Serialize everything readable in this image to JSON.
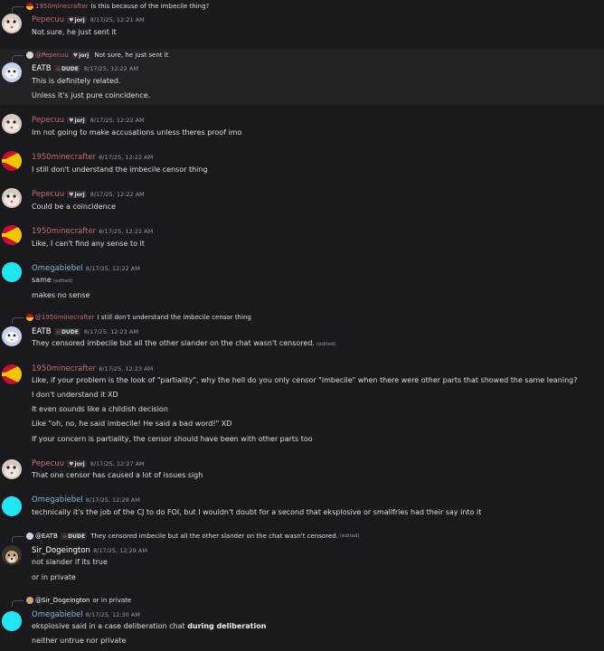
{
  "colors": {
    "pepecuu": "#c06b6b",
    "minecrafter": "#c06b6b",
    "eatb": "#ffffff",
    "omegabiebel": "#7ab8c8",
    "dogeington": "#ffffff",
    "mention": "#c9cdfb",
    "background": "#1a1a1e"
  },
  "messages": [
    {
      "reply": {
        "avatar_icon": "flag-icon",
        "name": "1950minecrafter",
        "text": "Is this because of the imbecile thing?"
      },
      "author": "Pepecuu",
      "tag": {
        "icon": "heart-icon",
        "label": "jorj"
      },
      "time": "8/17/25, 12:21 AM",
      "lines": [
        "Not sure, he just sent it"
      ]
    },
    {
      "reply": {
        "avatar_icon": "opossum-icon",
        "name": "@Pepecuu",
        "tag": "jorj",
        "text": "Not sure, he just sent it"
      },
      "author": "EATB",
      "tag": {
        "icon": "skull-icon",
        "label": "DUDE"
      },
      "time": "8/17/25, 12:22 AM",
      "lines": [
        "This is definitely related.",
        "Unless it's just pure coincidence."
      ]
    },
    {
      "author": "Pepecuu",
      "tag": {
        "icon": "heart-icon",
        "label": "jorj"
      },
      "time": "8/17/25, 12:22 AM",
      "lines": [
        "Im not going to make accusations unless theres proof imo"
      ]
    },
    {
      "author": "1950minecrafter",
      "time": "8/17/25, 12:22 AM",
      "lines": [
        "I still don't understand the imbecile censor thing"
      ]
    },
    {
      "author": "Pepecuu",
      "tag": {
        "icon": "heart-icon",
        "label": "jorj"
      },
      "time": "8/17/25, 12:22 AM",
      "lines": [
        "Could be a coincidence"
      ]
    },
    {
      "author": "1950minecrafter",
      "time": "8/17/25, 12:22 AM",
      "lines": [
        "Like, I can't find any sense to it"
      ]
    },
    {
      "author": "Omegabiebel",
      "time": "8/17/25, 12:22 AM",
      "lines": [
        "same",
        "makes no sense"
      ],
      "edited_label": "(edited)"
    },
    {
      "reply": {
        "avatar_icon": "flag-icon",
        "name": "@1950minecrafter",
        "text": "I still don't understand the imbecile censor thing"
      },
      "author": "EATB",
      "tag": {
        "icon": "skull-icon",
        "label": "DUDE"
      },
      "time": "8/17/25, 12:23 AM",
      "lines": [
        "They censored imbecile but all the other slander on the chat wasn't censored."
      ],
      "edited_label": "(edited)"
    },
    {
      "author": "1950minecrafter",
      "time": "8/17/25, 12:23 AM",
      "lines": [
        "Like, if your problem is the look of \"partiality\", why the hell do you only censor \"imbecile\" when there were other parts that showed the same leaning?",
        "I don't understand it XD",
        "It even sounds like a childish decision",
        "Like \"oh, no, he said imbecile! He said a bad word!\" XD",
        "If your concern is partiality, the censor should have been with other parts too"
      ]
    },
    {
      "author": "Pepecuu",
      "tag": {
        "icon": "heart-icon",
        "label": "jorj"
      },
      "time": "8/17/25, 12:27 AM",
      "lines": [
        "That one censor has caused a lot of issues sigh"
      ]
    },
    {
      "author": "Omegabiebel",
      "time": "8/17/25, 12:29 AM",
      "lines": [
        "technically it's the job of the CJ to do FOI, but I wouldn't doubt for a second that eksplosive or smallfries had their say into it"
      ]
    },
    {
      "reply": {
        "avatar_icon": "opossum-icon",
        "name": "@EATB",
        "tag": "DUDE",
        "text": "They censored imbecile but all the other slander on the chat wasn't censored.",
        "edited": "(edited)"
      },
      "author": "Sir_Dogeington",
      "time": "8/17/25, 12:29 AM",
      "lines": [
        "not slander if its true",
        "or in private"
      ]
    },
    {
      "reply": {
        "avatar_icon": "dog-icon",
        "name": "@Sir_Dogeington",
        "text": "or in private"
      },
      "author": "Omegabiebel",
      "time": "8/17/25, 12:30 AM",
      "lines": [
        "eksplosive said in a case deliberation chat",
        "neither untrue nor private"
      ],
      "bold_fragment": "during deliberation"
    }
  ]
}
